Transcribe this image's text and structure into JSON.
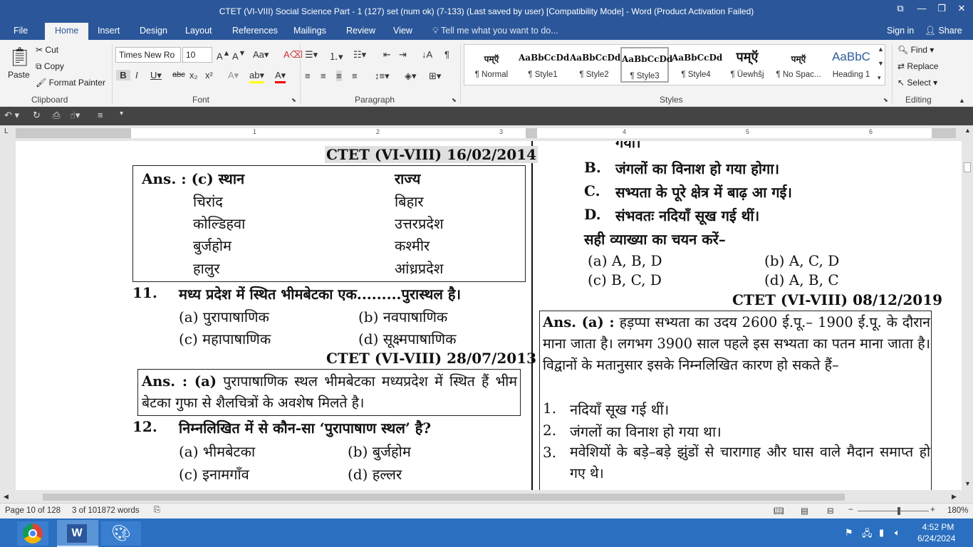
{
  "window": {
    "title": "CTET (VI-VIII) Social Science Part - 1 (127) set (num ok) (7-133) (Last saved by user) [Compatibility Mode] - Word (Product Activation Failed)"
  },
  "tabs": [
    "File",
    "Home",
    "Insert",
    "Design",
    "Layout",
    "References",
    "Mailings",
    "Review",
    "View"
  ],
  "tell_me": "Tell me what you want to do...",
  "account": {
    "signin": "Sign in",
    "share": "Share"
  },
  "clipboard": {
    "paste": "Paste",
    "cut": "Cut",
    "copy": "Copy",
    "format_painter": "Format Painter",
    "label": "Clipboard"
  },
  "font": {
    "name": "Times New Ro",
    "size": "10",
    "label": "Font"
  },
  "paragraph": {
    "label": "Paragraph"
  },
  "styles": {
    "label": "Styles",
    "items": [
      {
        "preview": "पम्ऍ",
        "name": "¶ Normal"
      },
      {
        "preview": "AaBbCcDd",
        "name": "¶ Style1"
      },
      {
        "preview": "AaBbCcDd",
        "name": "¶ Style2"
      },
      {
        "preview": "AaBbCcDd",
        "name": "¶ Style3"
      },
      {
        "preview": "AaBbCcDd",
        "name": "¶ Style4"
      },
      {
        "preview": "पम्ऍ",
        "name": "¶ Üewhšj"
      },
      {
        "preview": "पम्ऍ",
        "name": "¶ No Spac..."
      },
      {
        "preview": "AaBbC",
        "name": "Heading 1"
      }
    ]
  },
  "editing": {
    "find": "Find",
    "replace": "Replace",
    "select": "Select",
    "label": "Editing"
  },
  "ruler_numbers": [
    "1",
    "2",
    "3",
    "4",
    "5",
    "6"
  ],
  "doc": {
    "left": {
      "hdr1": "CTET (VI-VIII) 16/02/2014",
      "ans1": {
        "title": "Ans. : (c) स्थान",
        "col2": "राज्य",
        "rows": [
          [
            "चिरांद",
            "बिहार"
          ],
          [
            "कोल्डिहवा",
            "उत्तरप्रदेश"
          ],
          [
            "बुर्जहोम",
            "कश्मीर"
          ],
          [
            "हालुर",
            "आंध्रप्रदेश"
          ]
        ]
      },
      "q11": {
        "num": "11.",
        "text": "मध्य प्रदेश में स्थित भीमबेटका एक.........पुरास्थल है।",
        "opts": [
          "(a)  पुरापाषाणिक",
          "(b)  नवपाषाणिक",
          "(c)  महापाषाणिक",
          "(d)  सूक्ष्मपाषाणिक"
        ]
      },
      "hdr2": "CTET (VI-VIII) 28/07/2013",
      "ans2": {
        "lead": "Ans. : (a)",
        "text": "पुरापाषाणिक स्थल भीमबेटका मध्यप्रदेश में स्थित हैं भीम बेटका गुफा से शैलचित्रों के अवशेष मिलते है।"
      },
      "q12": {
        "num": "12.",
        "text": "निम्नलिखित में से कौन-सा ‘पुरापाषाण स्थल’ है?",
        "opts": [
          "(a)  भीमबेटका",
          "(b)  बुर्जहोम",
          "(c)  इनामगाँव",
          "(d)  हल्लर"
        ]
      }
    },
    "right": {
      "top_line": "गया।",
      "items": [
        [
          "B.",
          "जंगलों का विनाश हो गया होगा।"
        ],
        [
          "C.",
          "सभ्यता के पूरे क्षेत्र में बाढ़ आ गई।"
        ],
        [
          "D.",
          "संभवतः नदियाँ सूख गई थीं।"
        ]
      ],
      "choose": "सही व्याख्या का चयन करें–",
      "opts": [
        "(a)  A, B, D",
        "(b)  A, C, D",
        "(c)  B, C, D",
        "(d)  A, B, C"
      ],
      "hdr": "CTET (VI-VIII) 08/12/2019",
      "ans": {
        "lead": "Ans. (a) :",
        "text": "हड़प्पा सभ्यता का उदय 2600 ई.पू.– 1900 ई.पू. के दौरान माना जाता है। लगभग 3900 साल पहले इस सभ्यता का पतन माना जाता है। विद्वानों के मतानुसार इसके निम्नलिखित कारण हो सकते हैं–",
        "points": [
          [
            "1.",
            "नदियाँ सूख गई थीं।"
          ],
          [
            "2.",
            "जंगलों का विनाश हो गया था।"
          ],
          [
            "3.",
            "मवेशियों के बड़े–बड़े झुंडों से चारागाह और घास वाले मैदान समाप्त हो गए थे।"
          ]
        ]
      }
    }
  },
  "status": {
    "page": "Page 10 of 128",
    "words": "3 of 101872 words",
    "zoom": "180%"
  },
  "clock": {
    "time": "4:52 PM",
    "date": "6/24/2024"
  }
}
